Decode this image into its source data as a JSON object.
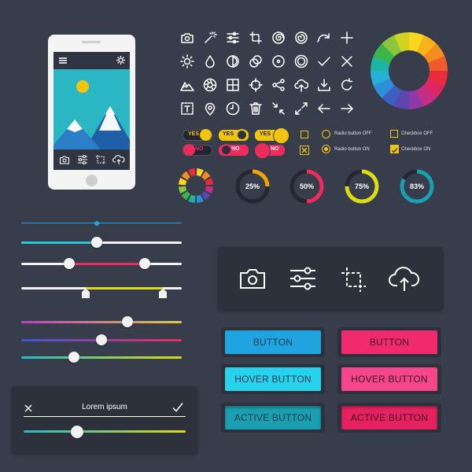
{
  "colors": {
    "background": "#373d4a",
    "yellow": "#f2c40c",
    "red": "#ef2b5e",
    "blue": "#1fa4df",
    "cyan": "#27c7e0",
    "teal": "#1a9fb1"
  },
  "phone": {
    "top_icons": [
      "hamburger-menu-icon",
      "gear-icon"
    ],
    "bottom_icons": [
      "camera-icon",
      "sliders-icon",
      "crop-icon",
      "cloud-upload-icon"
    ]
  },
  "icon_grid": [
    [
      "camera-icon",
      "magic-wand-icon",
      "sliders-icon",
      "crop-icon",
      "spiral-icon",
      "swirl-icon",
      "redo-arc-icon",
      "plus-icon"
    ],
    [
      "sun-icon",
      "drop-icon",
      "contrast-icon",
      "overlap-circles-icon",
      "circle-dot-icon",
      "target-ring-icon",
      "check-icon",
      "close-icon"
    ],
    [
      "mountains-icon",
      "aperture-icon",
      "grid-layout-icon",
      "crosshair-icon",
      "share-icon",
      "cloud-upload-icon",
      "download-icon",
      "refresh-icon"
    ],
    [
      "text-box-icon",
      "location-pin-icon",
      "clock-icon",
      "trash-icon",
      "shrink-icon",
      "expand-icon",
      "arrow-left-icon",
      "arrow-right-icon"
    ]
  ],
  "toggles": [
    {
      "label": "YES",
      "state": "on",
      "variant": "dark"
    },
    {
      "label": "YES",
      "state": "on",
      "variant": "yellow"
    },
    {
      "label": "YES",
      "state": "on",
      "variant": "yellow-large"
    },
    {
      "label": "NO",
      "state": "off",
      "variant": "dark"
    },
    {
      "label": "NO",
      "state": "off",
      "variant": "red"
    },
    {
      "label": "NO",
      "state": "off",
      "variant": "red-large"
    }
  ],
  "radios": [
    {
      "label": "Radio button OFF",
      "checked": false
    },
    {
      "label": "Radio button ON",
      "checked": true
    }
  ],
  "checkboxes": [
    {
      "label": "Checkbox OFF",
      "checked": false
    },
    {
      "label": "Checkbox ON",
      "checked": true
    }
  ],
  "progress_rings": [
    {
      "label": "25%",
      "value": 25,
      "color": "#f2a20c"
    },
    {
      "label": "50%",
      "value": 50,
      "color": "#ef2b5e"
    },
    {
      "label": "75%",
      "value": 75,
      "color": "#dcdc16"
    },
    {
      "label": "83%",
      "value": 83,
      "color": "#1a9fb1"
    }
  ],
  "sliders": [
    {
      "name": "thin-blue",
      "value": 0.47,
      "colors": [
        "#1fa4df"
      ]
    },
    {
      "name": "cyan",
      "value": 0.47,
      "colors": [
        "#27c7e0"
      ]
    },
    {
      "name": "range-red",
      "range": [
        0.3,
        0.77
      ],
      "colors": [
        "#ef2b5e"
      ]
    },
    {
      "name": "range-yellow",
      "range": [
        0.4,
        0.88
      ],
      "colors": [
        "#dcdc16"
      ]
    },
    {
      "name": "gradient-1",
      "value": 0.66,
      "colors": [
        "#c03bd1",
        "#e6c83a"
      ]
    },
    {
      "name": "gradient-2",
      "value": 0.5,
      "colors": [
        "#3c59d6",
        "#ef2b5e"
      ]
    },
    {
      "name": "gradient-3",
      "value": 0.33,
      "colors": [
        "#28b9c9",
        "#dcdc16"
      ]
    }
  ],
  "dialog": {
    "title": "Lorem ipsum",
    "close_icon": "close-icon",
    "confirm_icon": "check-icon",
    "slider_value": 0.33
  },
  "toolbar": {
    "icons": [
      "camera-icon",
      "sliders-icon",
      "crop-icon",
      "cloud-upload-icon"
    ]
  },
  "buttons": {
    "blue": [
      "BUTTON",
      "HOVER BUTTON",
      "ACTIVE BUTTON"
    ],
    "red": [
      "BUTTON",
      "HOVER BUTTON",
      "ACTIVE BUTTON"
    ]
  }
}
